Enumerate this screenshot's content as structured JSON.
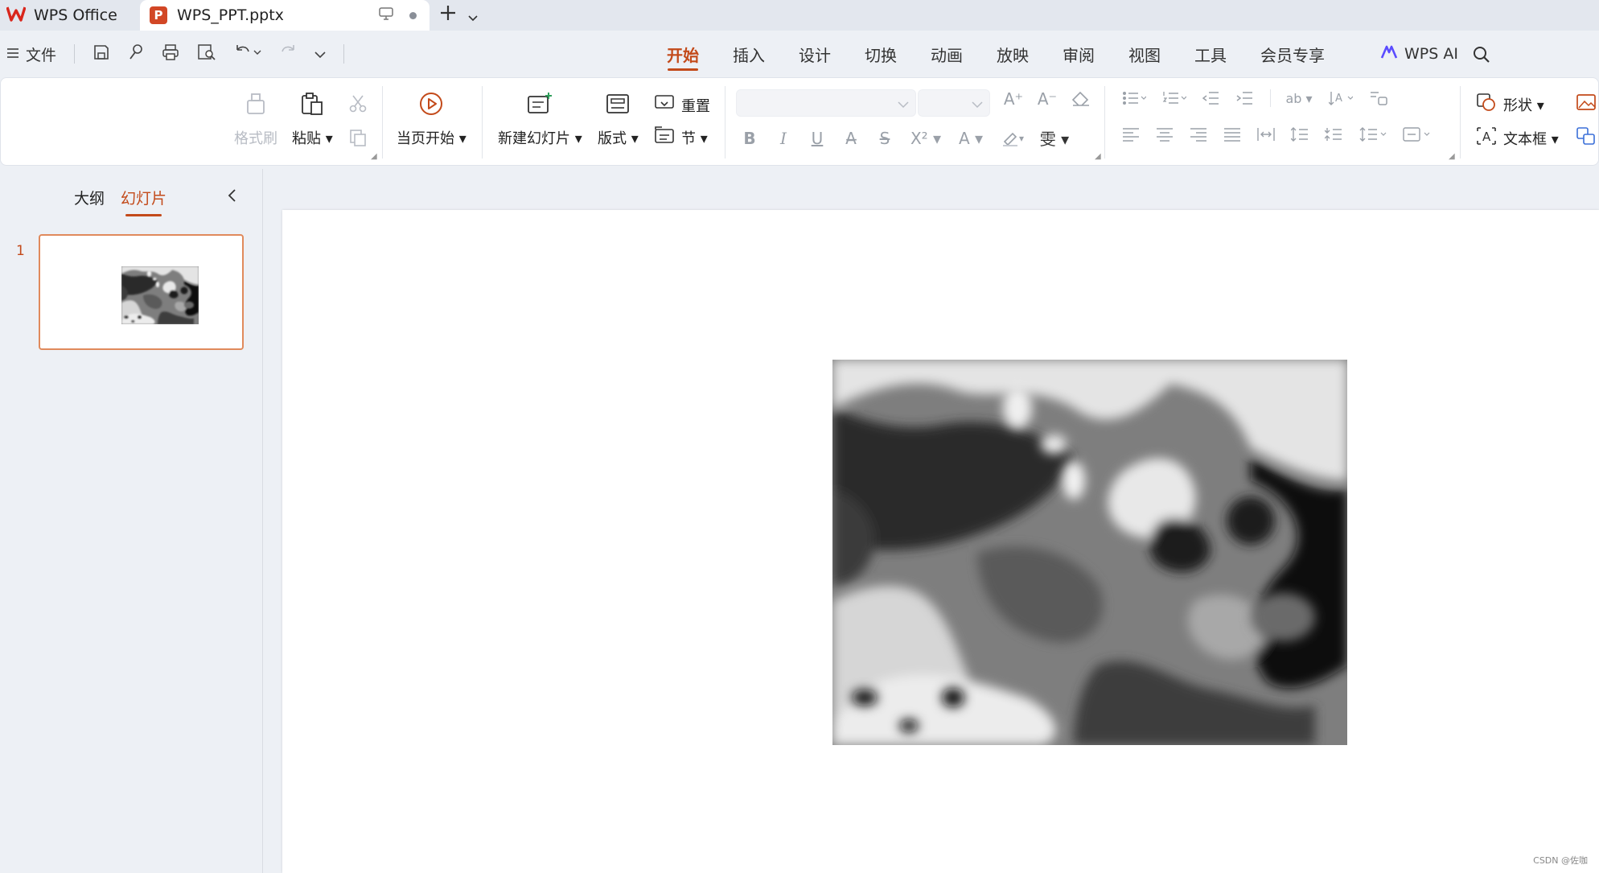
{
  "tabs": {
    "home_label": "WPS Office",
    "doc_label": "WPS_PPT.pptx",
    "doc_badge": "P"
  },
  "menu": {
    "file_label": "文件",
    "ribbon_tabs": [
      "开始",
      "插入",
      "设计",
      "切换",
      "动画",
      "放映",
      "审阅",
      "视图",
      "工具",
      "会员专享"
    ],
    "active_tab": "开始",
    "ai_label": "WPS AI"
  },
  "ribbon": {
    "format_painter": "格式刷",
    "paste": "粘贴",
    "from_current": "当页开始",
    "new_slide": "新建幻灯片",
    "layout": "版式",
    "reset": "重置",
    "section": "节",
    "shape": "形状",
    "textbox": "文本框"
  },
  "panel": {
    "outline_tab": "大纲",
    "slides_tab": "幻灯片",
    "slide_number": "1"
  },
  "watermark": "CSDN @佐咖",
  "colors": {
    "accent": "#c34a1a",
    "thumb_border": "#e08a5c",
    "ppt_brand": "#d24726"
  }
}
